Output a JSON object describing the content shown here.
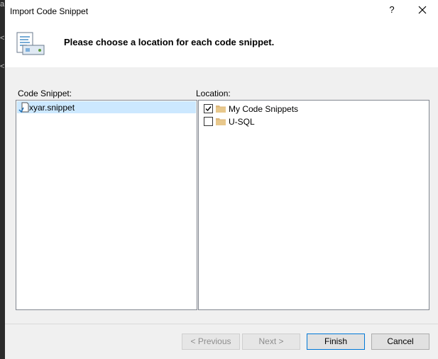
{
  "window": {
    "title": "Import Code Snippet",
    "help_label": "?"
  },
  "header": {
    "instruction": "Please choose a location for each code snippet."
  },
  "snippets": {
    "label": "Code Snippet:",
    "items": [
      {
        "name": "xyar.snippet",
        "selected": true
      }
    ]
  },
  "locations": {
    "label": "Location:",
    "items": [
      {
        "name": "My Code Snippets",
        "checked": true
      },
      {
        "name": "U-SQL",
        "checked": false
      }
    ]
  },
  "buttons": {
    "previous": "< Previous",
    "next": "Next >",
    "finish": "Finish",
    "cancel": "Cancel"
  },
  "colors": {
    "selection": "#cce8ff",
    "folder": "#dcb67a",
    "accent": "#0078d7"
  }
}
